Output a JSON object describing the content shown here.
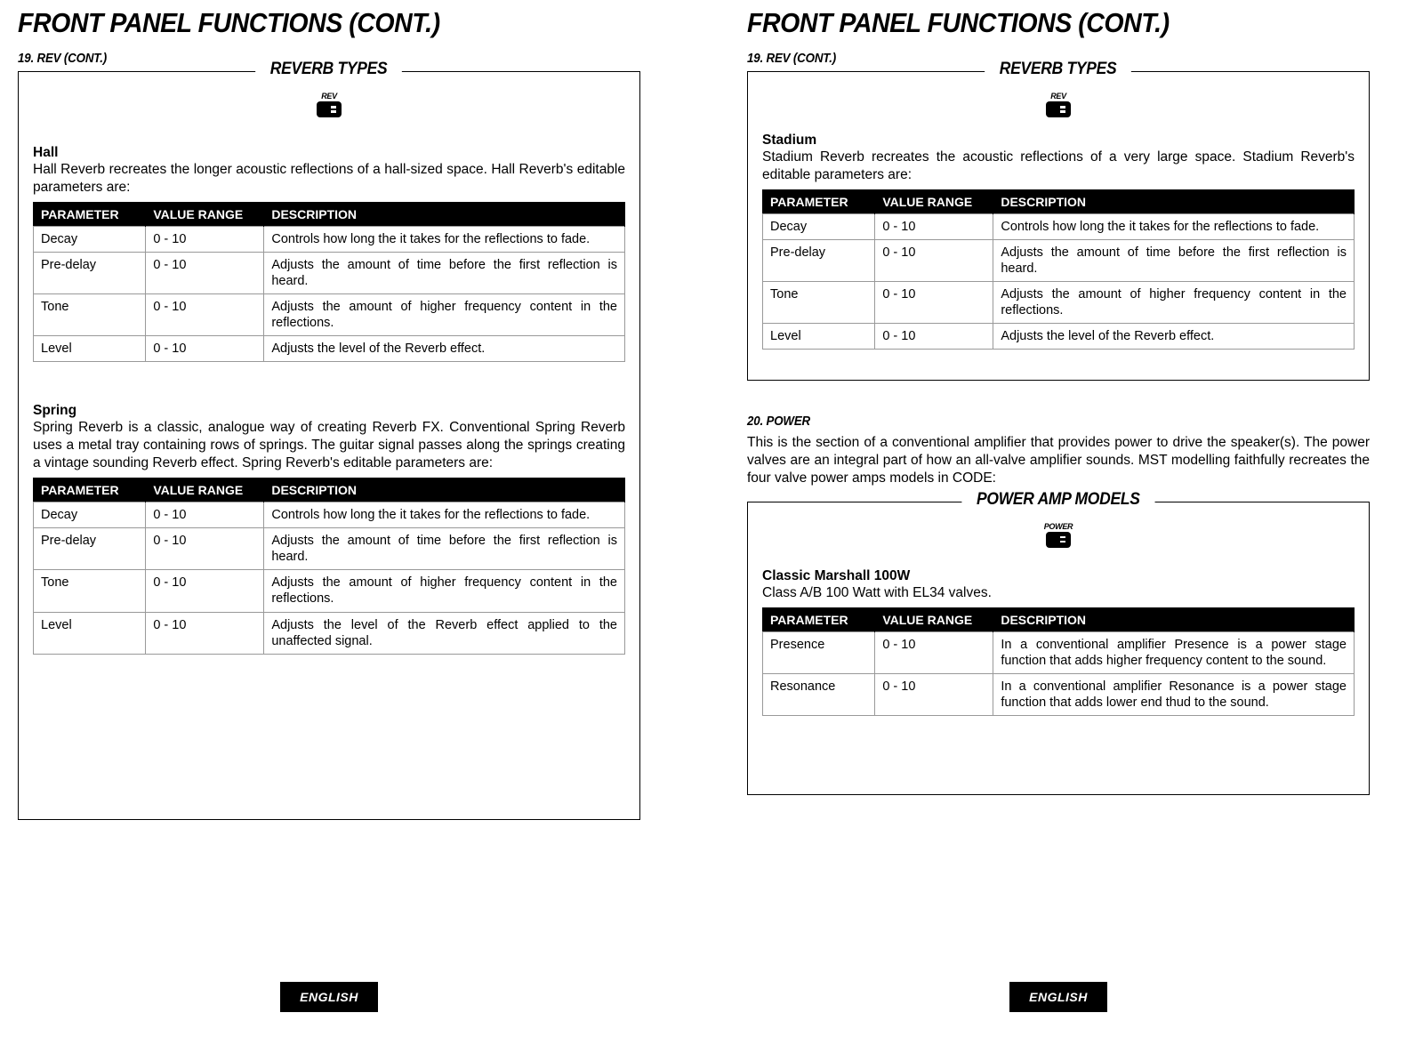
{
  "common": {
    "page_title": "FRONT PANEL FUNCTIONS (CONT.)",
    "section19_label": "19. REV (CONT.)",
    "reverb_types_label": "REVERB TYPES",
    "rev_icon_label": "REV",
    "power_icon_label": "POWER",
    "th_param": "PARAMETER",
    "th_range": "VALUE RANGE",
    "th_desc": "DESCRIPTION",
    "lang": "ENGLISH"
  },
  "left": {
    "hall": {
      "title": "Hall",
      "desc": "Hall Reverb recreates the longer acoustic reflections of a hall-sized space. Hall Reverb's editable parameters are:",
      "rows": [
        {
          "p": "Decay",
          "r": "0 - 10",
          "d": "Controls how long the it takes for the reflections to fade."
        },
        {
          "p": "Pre-delay",
          "r": "0 - 10",
          "d": "Adjusts the amount of time before the first reflection is heard."
        },
        {
          "p": "Tone",
          "r": "0 - 10",
          "d": "Adjusts the amount of higher frequency content in the reflections."
        },
        {
          "p": "Level",
          "r": "0 - 10",
          "d": "Adjusts the level of the Reverb effect."
        }
      ]
    },
    "spring": {
      "title": "Spring",
      "desc": "Spring Reverb is a classic, analogue way of creating Reverb FX. Conventional Spring Reverb uses a metal tray containing rows of springs. The guitar signal passes along the springs creating a vintage sounding Reverb effect. Spring Reverb's editable parameters are:",
      "rows": [
        {
          "p": "Decay",
          "r": "0 - 10",
          "d": "Controls how long the it takes for the reflections to fade."
        },
        {
          "p": "Pre-delay",
          "r": "0 - 10",
          "d": "Adjusts the amount of time before the first reflection is heard."
        },
        {
          "p": "Tone",
          "r": "0 - 10",
          "d": "Adjusts the amount of higher frequency content in the reflections."
        },
        {
          "p": "Level",
          "r": "0 - 10",
          "d": "Adjusts the level of the Reverb effect applied to the unaffected signal."
        }
      ]
    }
  },
  "right": {
    "stadium": {
      "title": "Stadium",
      "desc": "Stadium Reverb recreates the acoustic reflections of a very large space. Stadium Reverb's editable parameters are:",
      "rows": [
        {
          "p": "Decay",
          "r": "0 - 10",
          "d": "Controls how long the it takes for the reflections to fade."
        },
        {
          "p": "Pre-delay",
          "r": "0 - 10",
          "d": "Adjusts the amount of time before the first reflection is heard."
        },
        {
          "p": "Tone",
          "r": "0 - 10",
          "d": "Adjusts the amount of higher frequency content in the reflections."
        },
        {
          "p": "Level",
          "r": "0 - 10",
          "d": "Adjusts the level of the Reverb effect."
        }
      ]
    },
    "section20_label": "20. POWER",
    "section20_text": "This is the section of a conventional amplifier that provides power to drive the speaker(s). The power valves are an integral part of how an all-valve amplifier sounds. MST modelling faithfully recreates the four valve power amps models in CODE:",
    "power_models_label": "POWER AMP MODELS",
    "classic": {
      "title": "Classic Marshall 100W",
      "desc": "Class A/B 100 Watt with EL34 valves.",
      "rows": [
        {
          "p": "Presence",
          "r": "0 - 10",
          "d": "In a conventional amplifier Presence is a power stage function that adds higher frequency content to the sound."
        },
        {
          "p": "Resonance",
          "r": "0 - 10",
          "d": "In a conventional amplifier Resonance is a power stage function that adds lower end thud to the sound."
        }
      ]
    }
  }
}
